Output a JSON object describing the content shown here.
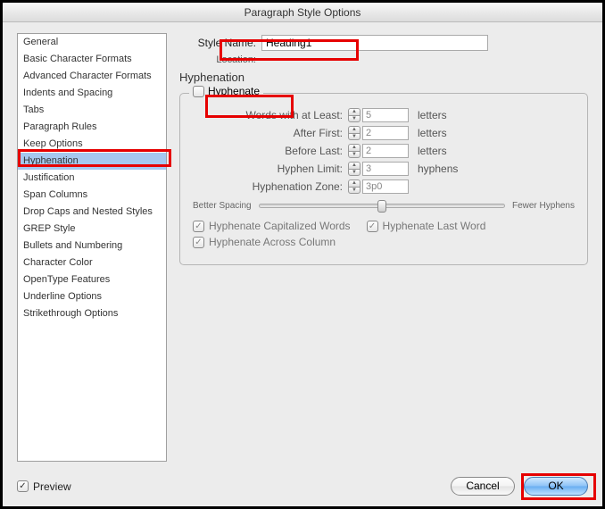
{
  "window": {
    "title": "Paragraph Style Options"
  },
  "header": {
    "style_name_label": "Style Name:",
    "style_name_value": "Heading1",
    "location_label": "Location:",
    "section_title": "Hyphenation"
  },
  "sidebar": {
    "items": [
      "General",
      "Basic Character Formats",
      "Advanced Character Formats",
      "Indents and Spacing",
      "Tabs",
      "Paragraph Rules",
      "Keep Options",
      "Hyphenation",
      "Justification",
      "Span Columns",
      "Drop Caps and Nested Styles",
      "GREP Style",
      "Bullets and Numbering",
      "Character Color",
      "OpenType Features",
      "Underline Options",
      "Strikethrough Options"
    ],
    "selected_index": 7
  },
  "hyphenation": {
    "legend": "Hyphenate",
    "fields": [
      {
        "label": "Words with at Least:",
        "value": "5",
        "unit": "letters"
      },
      {
        "label": "After First:",
        "value": "2",
        "unit": "letters"
      },
      {
        "label": "Before Last:",
        "value": "2",
        "unit": "letters"
      },
      {
        "label": "Hyphen Limit:",
        "value": "3",
        "unit": "hyphens"
      },
      {
        "label": "Hyphenation Zone:",
        "value": "3p0",
        "unit": ""
      }
    ],
    "slider": {
      "left": "Better Spacing",
      "right": "Fewer Hyphens"
    },
    "checks": [
      "Hyphenate Capitalized Words",
      "Hyphenate Last Word",
      "Hyphenate Across Column"
    ]
  },
  "footer": {
    "preview": "Preview",
    "cancel": "Cancel",
    "ok": "OK"
  }
}
